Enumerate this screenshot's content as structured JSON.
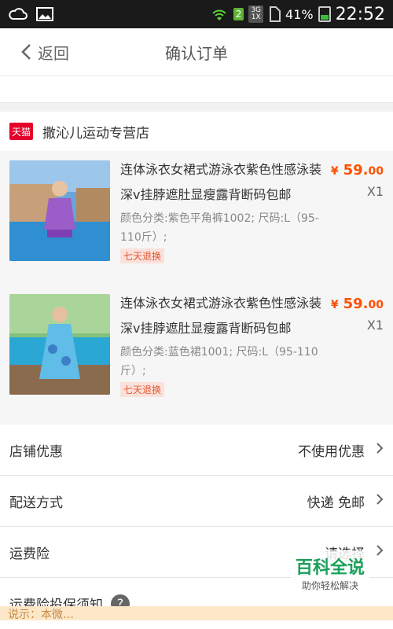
{
  "status_bar": {
    "signal": "3G",
    "network_top": "3G",
    "network_bottom": "1X",
    "sim": "2",
    "battery": "41%",
    "time": "22:52"
  },
  "header": {
    "back_label": "返回",
    "title": "确认订单"
  },
  "store": {
    "badge": "天猫",
    "name": "撒沁儿运动专营店"
  },
  "items": [
    {
      "name": "连体泳衣女裙式游泳衣紫色性感泳装深v挂脖遮肚显瘦露背断码包邮",
      "spec": "颜色分类:紫色平角裤1002; 尺码:L（95-110斤）;",
      "tag": "七天退换",
      "price_cur": "¥",
      "price_int": "59.",
      "price_dec": "00",
      "qty": "X1"
    },
    {
      "name": "连体泳衣女裙式游泳衣紫色性感泳装深v挂脖遮肚显瘦露背断码包邮",
      "spec": "颜色分类:蓝色裙1001; 尺码:L（95-110斤）;",
      "tag": "七天退换",
      "price_cur": "¥",
      "price_int": "59.",
      "price_dec": "00",
      "qty": "X1"
    }
  ],
  "options": {
    "shop_discount": {
      "label": "店铺优惠",
      "value": "不使用优惠"
    },
    "delivery": {
      "label": "配送方式",
      "value": "快递 免邮"
    },
    "shipping_insurance": {
      "label": "运费险",
      "value": "请选择"
    },
    "insurance_notice": {
      "label": "运费险投保须知",
      "help": "?"
    }
  },
  "watermark": {
    "title": "百科全说",
    "subtitle": "助你轻松解决"
  },
  "strip_text": "说示：本微…"
}
